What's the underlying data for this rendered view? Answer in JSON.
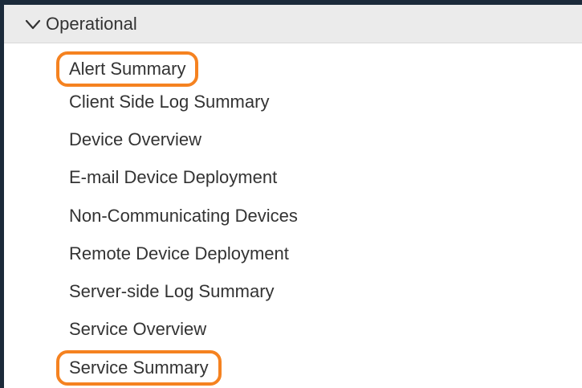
{
  "group": {
    "title": "Operational",
    "icon": "chevron-down-icon",
    "expanded": true
  },
  "items": [
    {
      "label": "Alert Summary",
      "highlighted": true
    },
    {
      "label": "Client Side Log Summary",
      "highlighted": false
    },
    {
      "label": "Device Overview",
      "highlighted": false
    },
    {
      "label": "E-mail Device Deployment",
      "highlighted": false
    },
    {
      "label": "Non-Communicating Devices",
      "highlighted": false
    },
    {
      "label": "Remote Device Deployment",
      "highlighted": false
    },
    {
      "label": "Server-side Log Summary",
      "highlighted": false
    },
    {
      "label": "Service Overview",
      "highlighted": false
    },
    {
      "label": "Service Summary",
      "highlighted": true
    }
  ],
  "colors": {
    "highlight_outline": "#f58220",
    "frame_background": "#1b2a3a",
    "header_background": "#ebebeb",
    "text": "#333333"
  }
}
